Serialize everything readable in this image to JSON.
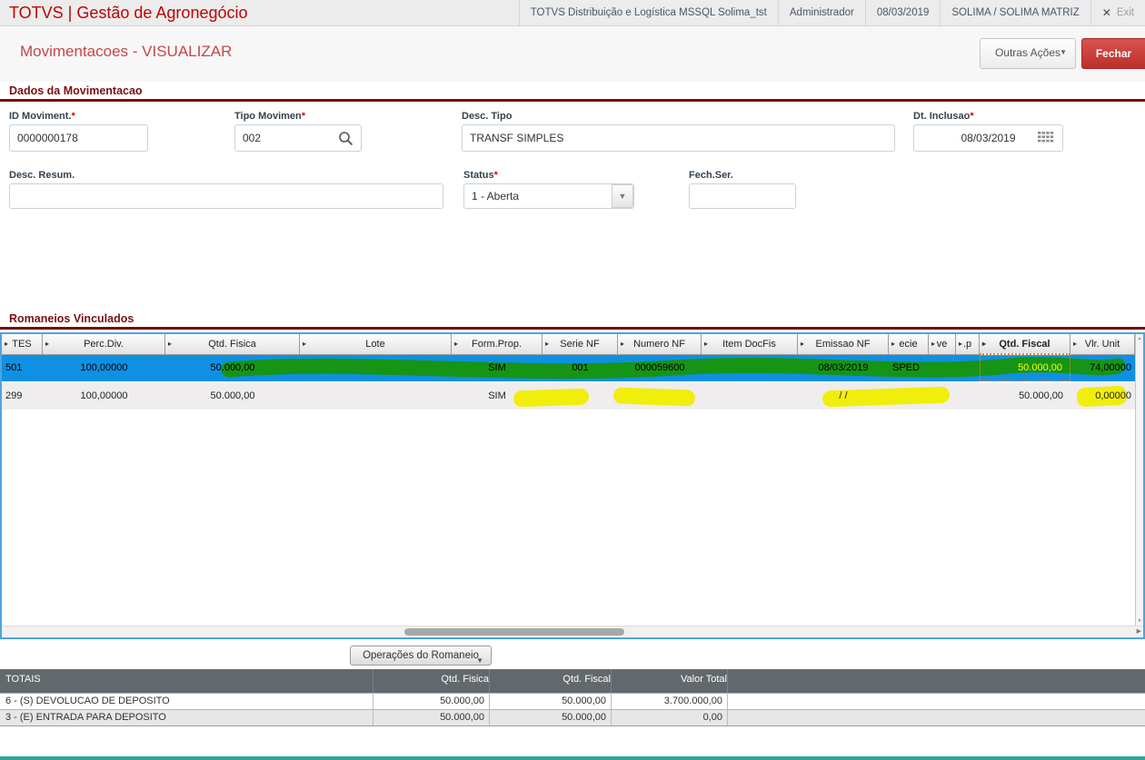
{
  "topbar": {
    "brand": "TOTVS | Gestão de Agronegócio",
    "environment": "TOTVS Distribuição e Logística MSSQL Solima_tst",
    "user": "Administrador",
    "date": "08/03/2019",
    "company": "SOLIMA / SOLIMA MATRIZ",
    "exit_label": "Exit"
  },
  "icons": {
    "close": "✕",
    "dropdown": "▼",
    "column_arrow": "▸",
    "scroll_right": "▶",
    "scroll_up": "▲",
    "scroll_down": "▼"
  },
  "page": {
    "title": "Movimentacoes - VISUALIZAR",
    "other_actions_label": "Outras Ações",
    "close_label": "Fechar"
  },
  "sections": {
    "dados": "Dados da Movimentacao",
    "romaneios": "Romaneios Vinculados"
  },
  "form": {
    "required_mark": "*",
    "id_moviment": {
      "label": "ID Moviment.",
      "value": "0000000178"
    },
    "tipo_movimen": {
      "label": "Tipo Movimen",
      "value": "002"
    },
    "desc_tipo": {
      "label": "Desc. Tipo",
      "value": "TRANSF SIMPLES"
    },
    "dt_inclusao": {
      "label": "Dt. Inclusao",
      "value": "08/03/2019"
    },
    "desc_resum": {
      "label": "Desc. Resum.",
      "value": ""
    },
    "status": {
      "label": "Status",
      "value": "1 - Aberta"
    },
    "fech_ser": {
      "label": "Fech.Ser.",
      "value": ""
    }
  },
  "grid": {
    "columns": [
      {
        "label": "TES"
      },
      {
        "label": "Perc.Div."
      },
      {
        "label": "Qtd. Fisica"
      },
      {
        "label": "Lote"
      },
      {
        "label": "Form.Prop."
      },
      {
        "label": "Serie NF"
      },
      {
        "label": "Numero NF"
      },
      {
        "label": "Item DocFis"
      },
      {
        "label": "Emissao NF"
      },
      {
        "label": "ecie"
      },
      {
        "label": "ve"
      },
      {
        "label": ".p"
      },
      {
        "label": "Qtd. Fiscal"
      },
      {
        "label": "Vlr. Unit"
      }
    ],
    "rows": [
      {
        "cells": [
          "501",
          "100,00000",
          "50.000,00",
          "",
          "SIM",
          "001",
          "000059600",
          "",
          "08/03/2019",
          "SPED",
          "",
          "",
          "50.000,00",
          "74,00000"
        ]
      },
      {
        "cells": [
          "299",
          "100,00000",
          "50.000,00",
          "",
          "SIM",
          "",
          "",
          "",
          "/ /",
          "",
          "",
          "",
          "50.000,00",
          "0,00000"
        ]
      }
    ]
  },
  "operations_button_label": "Operações do Romaneio",
  "totals": {
    "header": {
      "title": "TOTAIS",
      "qtd_fisica": "Qtd. Fisica",
      "qtd_fiscal": "Qtd. Fiscal",
      "valor_total": "Valor Total"
    },
    "rows": [
      {
        "label": "6 - (S) DEVOLUCAO DE DEPOSITO",
        "qtd_fisica": "50.000,00",
        "qtd_fiscal": "50.000,00",
        "valor_total": "3.700.000,00"
      },
      {
        "label": "3 - (E) ENTRADA PARA DEPOSITO",
        "qtd_fisica": "50.000,00",
        "qtd_fiscal": "50.000,00",
        "valor_total": "0,00"
      }
    ]
  },
  "colors": {
    "brand_red": "#c00202",
    "title_red": "#c44848",
    "section_maroon": "#750c0c",
    "selected_row_blue": "#0f90e2",
    "table_border_blue": "#4fa3de",
    "close_button_red": "#bc2f2a",
    "marker_green": "#169416",
    "marker_yellow": "#f0ee0a",
    "selected_cell_text": "#ffff00",
    "totals_header_gray": "#62686c",
    "bottom_bar_teal": "#2fa5a0"
  }
}
